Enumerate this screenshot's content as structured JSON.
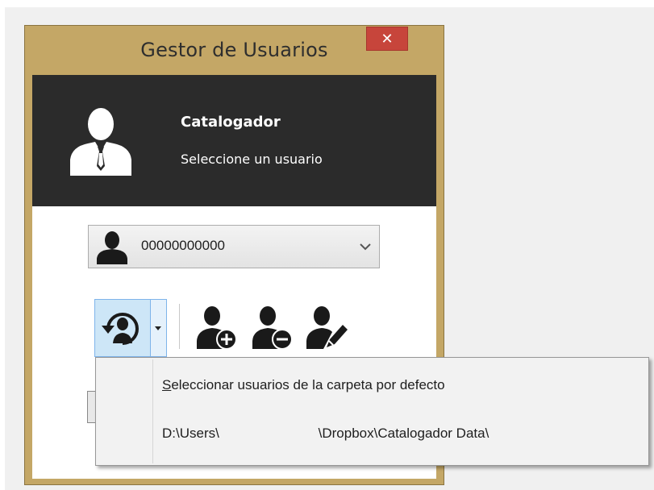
{
  "window": {
    "title": "Gestor de Usuarios",
    "close_glyph": "✕"
  },
  "header": {
    "app_name": "Catalogador",
    "subtitle": "Seleccione un usuario",
    "icon": "user-silhouette-icon"
  },
  "user_select": {
    "selected_value": "00000000000",
    "icon": "user-icon",
    "arrow": "chevron-down-icon"
  },
  "toolbar": {
    "split_button_icon": "user-sync-icon",
    "buttons": [
      {
        "icon": "add-user-icon"
      },
      {
        "icon": "remove-user-icon"
      },
      {
        "icon": "edit-user-icon"
      }
    ]
  },
  "context_menu": {
    "items": [
      {
        "mnemonic": "S",
        "label_rest": "eleccionar usuarios de la carpeta por defecto"
      },
      {
        "label": "D:\\Users\\                          \\Dropbox\\Catalogador Data\\"
      }
    ]
  },
  "colors": {
    "window_frame": "#c4a766",
    "header_band": "#2b2b2b",
    "close_button": "#c7453b",
    "split_button_highlight": "#cde6f7"
  }
}
